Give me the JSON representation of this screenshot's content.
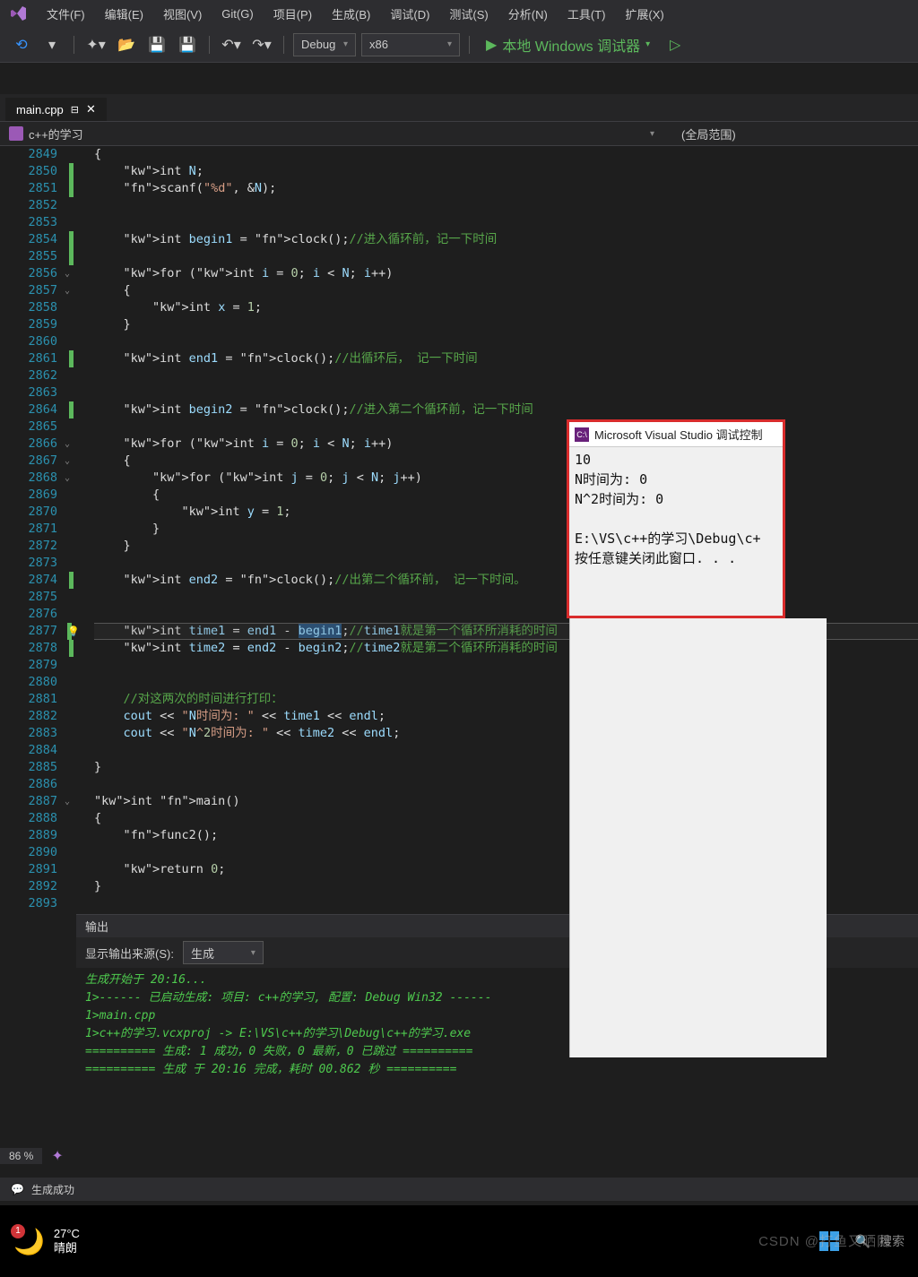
{
  "menubar": [
    "文件(F)",
    "编辑(E)",
    "视图(V)",
    "Git(G)",
    "项目(P)",
    "生成(B)",
    "调试(D)",
    "测试(S)",
    "分析(N)",
    "工具(T)",
    "扩展(X)"
  ],
  "toolbar": {
    "config": "Debug",
    "platform": "x86",
    "debugger": "本地 Windows 调试器"
  },
  "tab": {
    "name": "main.cpp"
  },
  "scope": {
    "left": "c++的学习",
    "right": "(全局范围)"
  },
  "code": {
    "lines": [
      {
        "n": 2849,
        "t": "{"
      },
      {
        "n": 2850,
        "t": "    int N;",
        "c": true
      },
      {
        "n": 2851,
        "t": "    scanf(\"%d\", &N);",
        "c": true
      },
      {
        "n": 2852,
        "t": ""
      },
      {
        "n": 2853,
        "t": ""
      },
      {
        "n": 2854,
        "t": "    int begin1 = clock();//进入循环前，记一下时间",
        "c": true
      },
      {
        "n": 2855,
        "t": "",
        "c": true
      },
      {
        "n": 2856,
        "t": "    for (int i = 0; i < N; i++)",
        "fold": "v"
      },
      {
        "n": 2857,
        "t": "    {",
        "fold": "v"
      },
      {
        "n": 2858,
        "t": "        int x = 1;"
      },
      {
        "n": 2859,
        "t": "    }"
      },
      {
        "n": 2860,
        "t": ""
      },
      {
        "n": 2861,
        "t": "    int end1 = clock();//出循环后， 记一下时间",
        "c": true
      },
      {
        "n": 2862,
        "t": ""
      },
      {
        "n": 2863,
        "t": ""
      },
      {
        "n": 2864,
        "t": "    int begin2 = clock();//进入第二个循环前，记一下时间",
        "c": true
      },
      {
        "n": 2865,
        "t": ""
      },
      {
        "n": 2866,
        "t": "    for (int i = 0; i < N; i++)",
        "fold": "v"
      },
      {
        "n": 2867,
        "t": "    {",
        "fold": "v"
      },
      {
        "n": 2868,
        "t": "        for (int j = 0; j < N; j++)",
        "fold": "v"
      },
      {
        "n": 2869,
        "t": "        {"
      },
      {
        "n": 2870,
        "t": "            int y = 1;"
      },
      {
        "n": 2871,
        "t": "        }"
      },
      {
        "n": 2872,
        "t": "    }"
      },
      {
        "n": 2873,
        "t": ""
      },
      {
        "n": 2874,
        "t": "    int end2 = clock();//出第二个循环前， 记一下时间。",
        "c": true
      },
      {
        "n": 2875,
        "t": ""
      },
      {
        "n": 2876,
        "t": ""
      },
      {
        "n": 2877,
        "t": "    int time1 = end1 - begin1;//time1就是第一个循环所消耗的时间",
        "bulb": true,
        "hl": true,
        "c": true
      },
      {
        "n": 2878,
        "t": "    int time2 = end2 - begin2;//time2就是第二个循环所消耗的时间",
        "c": true
      },
      {
        "n": 2879,
        "t": ""
      },
      {
        "n": 2880,
        "t": ""
      },
      {
        "n": 2881,
        "t": "    //对这两次的时间进行打印："
      },
      {
        "n": 2882,
        "t": "    cout << \"N时间为: \" << time1 << endl;"
      },
      {
        "n": 2883,
        "t": "    cout << \"N^2时间为: \" << time2 << endl;"
      },
      {
        "n": 2884,
        "t": ""
      },
      {
        "n": 2885,
        "t": "}"
      },
      {
        "n": 2886,
        "t": ""
      },
      {
        "n": 2887,
        "t": "int main()",
        "fold": "v"
      },
      {
        "n": 2888,
        "t": "{"
      },
      {
        "n": 2889,
        "t": "    func2();"
      },
      {
        "n": 2890,
        "t": ""
      },
      {
        "n": 2891,
        "t": "    return 0;"
      },
      {
        "n": 2892,
        "t": "}"
      },
      {
        "n": 2893,
        "t": ""
      }
    ]
  },
  "output": {
    "title": "输出",
    "source_label": "显示输出来源(S):",
    "source_value": "生成",
    "lines": [
      "生成开始于 20:16...",
      "1>------ 已启动生成: 项目: c++的学习, 配置: Debug Win32 ------",
      "1>main.cpp",
      "1>c++的学习.vcxproj -> E:\\VS\\c++的学习\\Debug\\c++的学习.exe",
      "========== 生成: 1 成功，0 失败，0 最新，0 已跳过 ==========",
      "========== 生成 于 20:16 完成，耗时 00.862 秒 =========="
    ]
  },
  "zoom": "86 %",
  "status": "生成成功",
  "console": {
    "title": "Microsoft Visual Studio 调试控制",
    "body": "10\nN时间为: 0\nN^2时间为: 0\n\nE:\\VS\\c++的学习\\Debug\\c+\n按任意键关闭此窗口. . ."
  },
  "taskbar": {
    "temp": "27°C",
    "cond": "晴朗",
    "badge": "1",
    "search": "搜索"
  },
  "watermark": "CSDN @打鱼又晒网"
}
